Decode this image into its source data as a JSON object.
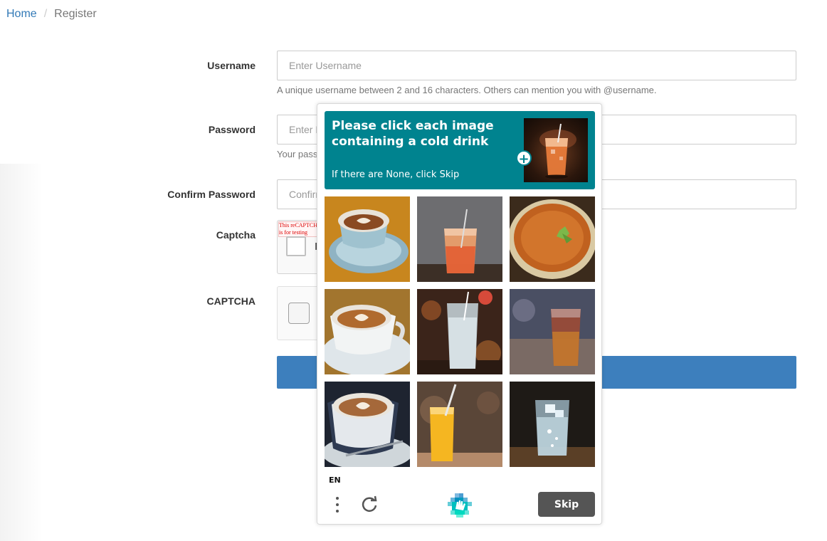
{
  "breadcrumb": {
    "home": "Home",
    "separator": "/",
    "current": "Register"
  },
  "form": {
    "username": {
      "label": "Username",
      "placeholder": "Enter Username",
      "help": "A unique username between 2 and 16 characters. Others can mention you with @username."
    },
    "password": {
      "label": "Password",
      "placeholder": "Enter Password",
      "help": "Your pass"
    },
    "confirm": {
      "label": "Confirm Password",
      "placeholder": "Confirm Password"
    },
    "captcha1": {
      "label": "Captcha",
      "warning": "This reCAPTCHA is for testing purposes only. Please report to the site admin if you are seeing this.",
      "checkbox_label": "I"
    },
    "captcha2": {
      "label": "CAPTCHA"
    }
  },
  "challenge": {
    "title": "Please click each image containing a cold drink",
    "subtitle": "If there are None, click Skip",
    "language": "EN",
    "skip_label": "Skip",
    "tiles": [
      {
        "subject": "latte art coffee cup"
      },
      {
        "subject": "iced orange drink with straw"
      },
      {
        "subject": "bowl of soup"
      },
      {
        "subject": "latte art coffee cup"
      },
      {
        "subject": "iced sparkling water"
      },
      {
        "subject": "iced tea glass"
      },
      {
        "subject": "latte art coffee cup"
      },
      {
        "subject": "orange juice with straw"
      },
      {
        "subject": "glass of ice water"
      }
    ]
  },
  "colors": {
    "link": "#337ab7",
    "primary_button": "#3d7fbd",
    "challenge_header": "#00838f",
    "skip_button": "#555555"
  },
  "icons": {
    "add": "plus-icon",
    "menu": "vertical-dots-icon",
    "refresh": "refresh-icon",
    "brand": "hcaptcha-logo-icon"
  }
}
